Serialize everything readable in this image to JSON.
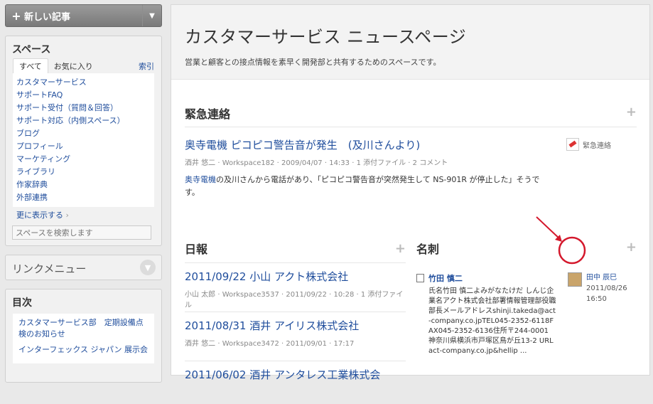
{
  "sidebar": {
    "new_article_label": "新しい記事",
    "spaces": {
      "title": "スペース",
      "tabs": [
        "すべて",
        "お気に入り"
      ],
      "index_label": "索引",
      "items": [
        "カスタマーサービス",
        "サポートFAQ",
        "サポート受付（質問＆回答）",
        "サポート対応（内側スペース）",
        "ブログ",
        "プロフィール",
        "マーケティング",
        "ライブラリ",
        "作家辞典",
        "外部連携"
      ],
      "more_label": "更に表示する",
      "search_placeholder": "スペースを検索します"
    },
    "link_menu": {
      "title": "リンクメニュー"
    },
    "toc": {
      "title": "目次",
      "items": [
        "カスタマーサービス部　定期設備点検のお知らせ",
        "インターフェックス ジャパン 展示会"
      ]
    }
  },
  "main": {
    "title": "カスタマーサービス ニュースページ",
    "description": "営業と顧客との接点情報を素早く開発部と共有するためのスペースです。",
    "urgent": {
      "title": "緊急連絡",
      "article": {
        "title": "奥寺電機 ピコピコ警告音が発生　(及川さんより)",
        "author": "酒井 悠二",
        "workspace": "Workspace182",
        "date": "2009/04/07 · 14:33",
        "attachments": "1 添付ファイル",
        "comments": "2 コメント",
        "body_link": "奥寺電機",
        "body": "の及川さんから電話があり、「ピコピコ警告音が突然発生して NS-901R が停止した」そうです。"
      },
      "tag": "緊急連絡"
    },
    "nippo": {
      "title": "日報",
      "reports": [
        {
          "title": "2011/09/22 小山 アクト株式会社",
          "meta": "小山 太郎 · Workspace3537 · 2011/09/22 · 10:28 · 1 添付ファイル"
        },
        {
          "title": "2011/08/31 酒井 アイリス株式会社",
          "meta": "酒井 悠二 · Workspace3472 · 2011/09/01 · 17:17"
        },
        {
          "title": "2011/06/02 酒井 アンタレス工業株式会",
          "meta": ""
        }
      ]
    },
    "meishi": {
      "title": "名刺",
      "card": {
        "name": "竹田 慎二",
        "detail": "氏名竹田 慎二よみがなたけだ しんじ企業名アクト株式会社部署情報管理部役職部長メールアドレスshinji.takeda@act-company.co.jpTEL045-2352-6118FAX045-2352-6136住所〒244-0001 神奈川県横浜市戸塚区鳥が丘13-2 URLact-company.co.jp&hellip ..."
      },
      "author": {
        "name": "田中 辰巳",
        "date": "2011/08/26",
        "time": "16:50"
      }
    }
  }
}
